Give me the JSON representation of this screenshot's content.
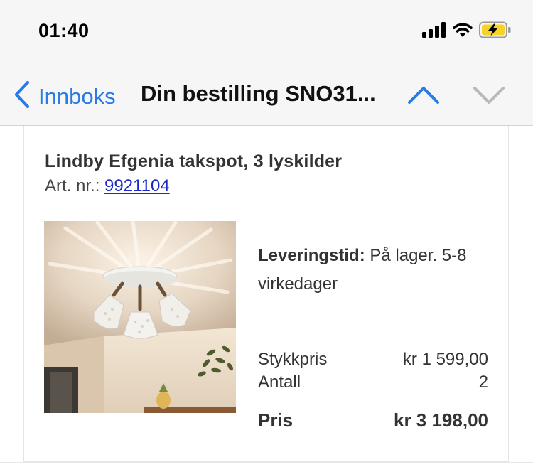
{
  "status": {
    "time": "01:40"
  },
  "nav": {
    "back_label": "Innboks",
    "title": "Din bestilling SNO31..."
  },
  "product": {
    "name": "Lindby Efgenia takspot, 3 lyskilder",
    "art_label": "Art. nr.:",
    "art_number": "9921104",
    "delivery_label": "Leveringstid:",
    "delivery_value": "På lager. 5-8 virkedager",
    "unit_price_label": "Stykkpris",
    "unit_price_value": "kr 1 599,00",
    "quantity_label": "Antall",
    "quantity_value": "2",
    "total_label": "Pris",
    "total_value": "kr 3 198,00"
  },
  "colors": {
    "accent": "#2a7be4",
    "link": "#1a29c8",
    "battery_fill": "#f5d327"
  },
  "icons": {
    "back": "chevron-left-icon",
    "prev": "chevron-up-icon",
    "next": "chevron-down-icon",
    "signal": "cellular-signal-icon",
    "wifi": "wifi-icon",
    "battery": "battery-charging-icon"
  }
}
